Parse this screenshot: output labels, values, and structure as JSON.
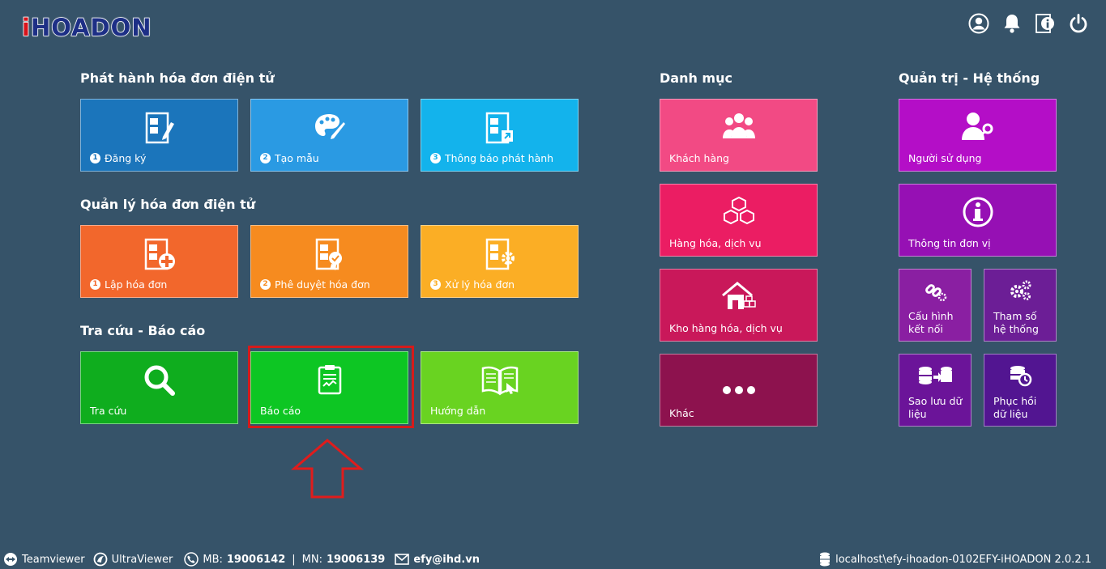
{
  "logo": {
    "i": "i",
    "rest": "HOADON"
  },
  "sections": {
    "phathanh": "Phát hành hóa đơn điện tử",
    "quanly": "Quản lý hóa đơn điện tử",
    "tracuu": "Tra cứu - Báo cáo",
    "danhmuc": "Danh mục",
    "quantri": "Quản trị - Hệ thống"
  },
  "tiles": {
    "dangky": {
      "num": "1",
      "label": "Đăng ký",
      "color": "#1b75bb"
    },
    "taomau": {
      "num": "2",
      "label": "Tạo mẫu",
      "color": "#2a9ae3"
    },
    "thongbao": {
      "num": "3",
      "label": "Thông báo phát hành",
      "color": "#13b3ec"
    },
    "laphoadon": {
      "num": "1",
      "label": "Lập hóa đơn",
      "color": "#f2672c"
    },
    "pheduyet": {
      "num": "2",
      "label": "Phê duyệt hóa đơn",
      "color": "#f68b1f"
    },
    "xuly": {
      "num": "3",
      "label": "Xử lý hóa đơn",
      "color": "#fbae25"
    },
    "tracuu": {
      "label": "Tra cứu",
      "color": "#0fad1e"
    },
    "baocao": {
      "label": "Báo cáo",
      "color": "#0dc623"
    },
    "huongdan": {
      "label": "Hướng dẫn",
      "color": "#69d321"
    },
    "khachhang": {
      "label": "Khách hàng",
      "color": "#f24a84"
    },
    "hanghoa": {
      "label": "Hàng hóa, dịch vụ",
      "color": "#eb1d63"
    },
    "kho": {
      "label": "Kho hàng hóa, dịch vụ",
      "color": "#c9185a"
    },
    "khac": {
      "label": "Khác",
      "color": "#8d124e"
    },
    "nguoisudung": {
      "label": "Người sử dụng",
      "color": "#b40ec7"
    },
    "thongtin": {
      "label": "Thông tin đơn vị",
      "color": "#9610b4"
    },
    "cauhinh": {
      "label": "Cấu hình\nkết nối",
      "color": "#8a1fa2"
    },
    "thamso": {
      "label": "Tham số\nhệ thống",
      "color": "#6c1e96"
    },
    "saoluu": {
      "label": "Sao lưu dữ\nliệu",
      "color": "#6b1499"
    },
    "phuchoi": {
      "label": "Phục hồi\ndữ liệu",
      "color": "#521591"
    }
  },
  "footer": {
    "teamviewer": "Teamviewer",
    "ultraviewer": "UltraViewer",
    "mb_label": "MB:",
    "mb_value": "19006142",
    "separator": "|",
    "mn_label": "MN:",
    "mn_value": "19006139",
    "email": "efy@ihd.vn",
    "server": "localhost\\efy-ihoadon-0102",
    "version": "EFY-iHOADON 2.0.2.1"
  }
}
